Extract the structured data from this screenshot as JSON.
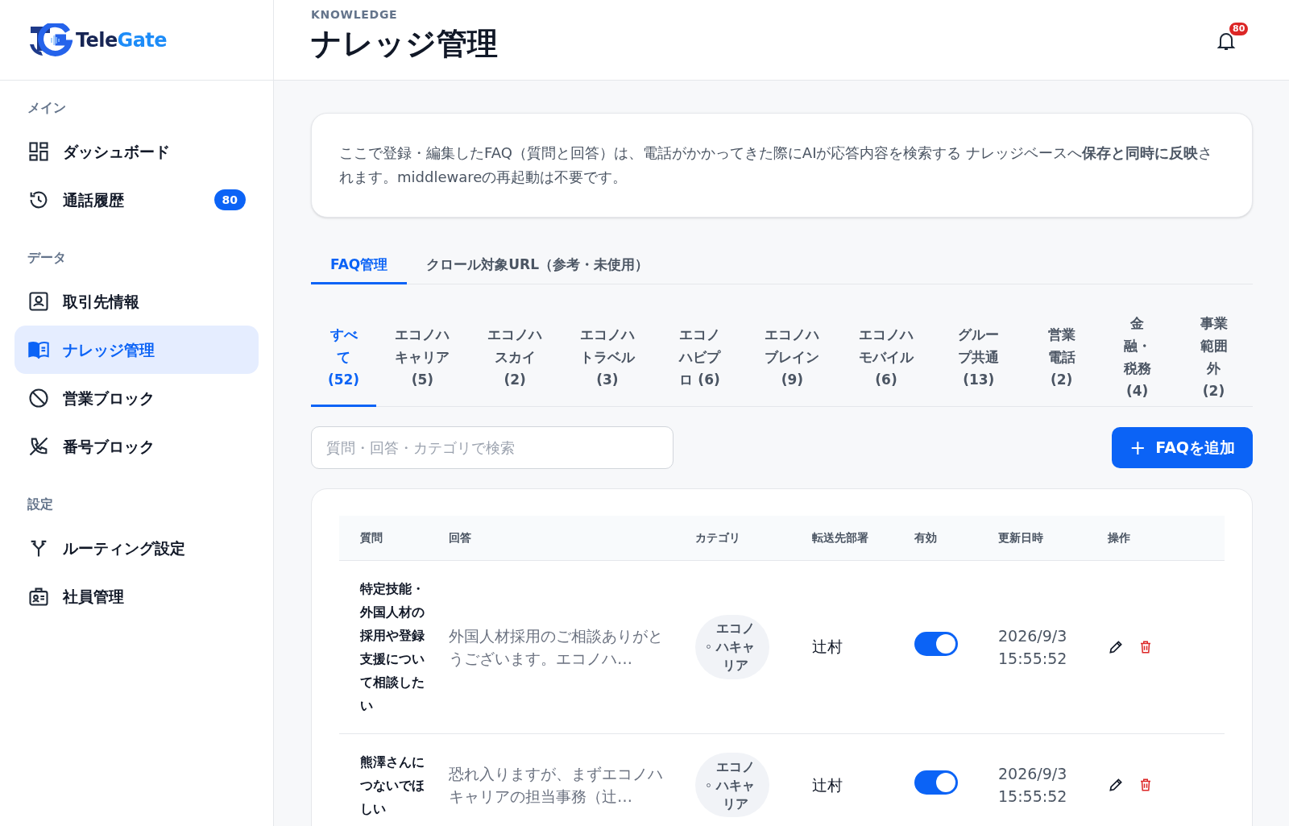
{
  "brand": {
    "name_part1": "Tele",
    "name_part2": "Gate"
  },
  "sidebar": {
    "sections": [
      {
        "title": "メイン",
        "items": [
          {
            "label": "ダッシュボード",
            "selected": false
          },
          {
            "label": "通話履歴",
            "badge": "80",
            "selected": false
          }
        ]
      },
      {
        "title": "データ",
        "items": [
          {
            "label": "取引先情報",
            "selected": false
          },
          {
            "label": "ナレッジ管理",
            "selected": true
          },
          {
            "label": "営業ブロック",
            "selected": false
          },
          {
            "label": "番号ブロック",
            "selected": false
          }
        ]
      },
      {
        "title": "設定",
        "items": [
          {
            "label": "ルーティング設定",
            "selected": false
          },
          {
            "label": "社員管理",
            "selected": false
          }
        ]
      }
    ]
  },
  "header": {
    "eyebrow": "KNOWLEDGE",
    "title": "ナレッジ管理",
    "notification_count": "80"
  },
  "notice": "ここで登録・編集したFAQ（質問と回答）は、電話がかかってきた際にAIが応答内容を検索する ナレッジベースへ**保存と同時に反映**されます。middlewareの再起動は不要です。",
  "tabs": [
    {
      "label": "FAQ管理",
      "selected": true
    },
    {
      "label": "クロール対象URL（参考・未使用）",
      "selected": false
    }
  ],
  "categories": [
    {
      "label": "すべて (52)",
      "selected": true
    },
    {
      "label": "エコノハキャリア (5)",
      "selected": false
    },
    {
      "label": "エコノハスカイ (2)",
      "selected": false
    },
    {
      "label": "エコノハトラベル (3)",
      "selected": false
    },
    {
      "label": "エコノハビプロ (6)",
      "selected": false
    },
    {
      "label": "エコノハブレイン (9)",
      "selected": false
    },
    {
      "label": "エコノハモバイル (6)",
      "selected": false
    },
    {
      "label": "グループ共通 (13)",
      "selected": false
    },
    {
      "label": "営業電話 (2)",
      "selected": false
    },
    {
      "label": "金融・税務 (4)",
      "selected": false
    },
    {
      "label": "事業範囲外 (2)",
      "selected": false
    }
  ],
  "search": {
    "placeholder": "質問・回答・カテゴリで検索"
  },
  "add_button": {
    "icon": "+",
    "label": "FAQを追加"
  },
  "table": {
    "columns": [
      "質問",
      "回答",
      "カテゴリ",
      "転送先部署",
      "有効",
      "更新日時",
      "操作"
    ],
    "rows": [
      {
        "question": "特定技能・外国人材の採用や登録支援について相談したい",
        "answer": "外国人材採用のご相談ありがとうございます。エコノハ…",
        "category": "エコノハキャリア",
        "department": "辻村",
        "enabled": true,
        "updated": "2026/9/3 15:55:52"
      },
      {
        "question": "熊澤さんにつないでほしい",
        "answer": "恐れ入りますが、まずエコノハキャリアの担当事務（辻…",
        "category": "エコノハキャリア",
        "department": "辻村",
        "enabled": true,
        "updated": "2026/9/3 15:55:52"
      }
    ]
  }
}
